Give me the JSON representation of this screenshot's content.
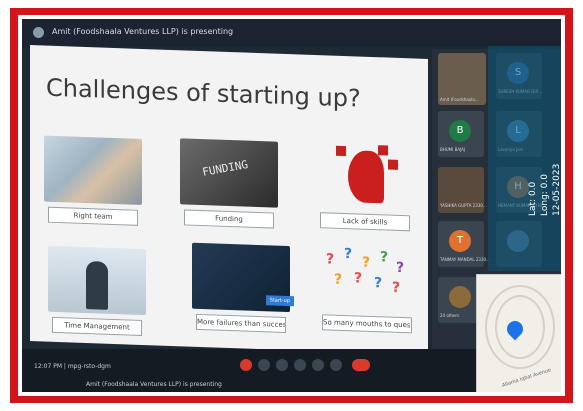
{
  "meeting": {
    "presenting_text": "Amit (Foodshaala Ventures LLP) is presenting",
    "bottom_presenting_text": "Amit (Foodshaala Ventures LLP) is presenting",
    "time_text": "12:07 PM | mpg-rsto-dgm"
  },
  "slide": {
    "title": "Challenges of starting up?",
    "cards": [
      {
        "label": "Right team"
      },
      {
        "label": "Funding",
        "image_text": "FUNDING"
      },
      {
        "label": "Lack of skills"
      },
      {
        "label": "Time Management"
      },
      {
        "label": "More failures than success",
        "badge": "Start-up"
      },
      {
        "label": "So many mouths to question"
      }
    ]
  },
  "participants": [
    {
      "initial": "",
      "name": "Amit (Foodshaala...",
      "color": "#6a5d4d"
    },
    {
      "initial": "S",
      "name": "SURESH KUMAR DIX...",
      "color": "#3d6ea8"
    },
    {
      "initial": "B",
      "name": "BHUMI BAJAJ",
      "color": "#1f7a45"
    },
    {
      "initial": "L",
      "name": "Lavanya Jain",
      "color": "#4a88b5"
    },
    {
      "initial": "",
      "name": "YASHIKA GUPTA 2330...",
      "color": "#6d4e3c"
    },
    {
      "initial": "H",
      "name": "HEMANT KUMAR 2330...",
      "color": "#a97047"
    },
    {
      "initial": "T",
      "name": "TANMAY MANDAL 2330...",
      "color": "#e07030"
    },
    {
      "initial": "",
      "name": "",
      "color": "#5a7a9b"
    },
    {
      "initial": "",
      "name": "24 others",
      "color": "#8b6b3a"
    }
  ],
  "geo": {
    "lat": "Lat: 0.0",
    "long": "Long: 0.0",
    "date": "12-05-2023",
    "map_street": "Allama Iqbal Avenue"
  },
  "colors": {
    "frame": "#d4141b",
    "panel": "#27303a",
    "slide_bg": "#f3f3f3"
  }
}
